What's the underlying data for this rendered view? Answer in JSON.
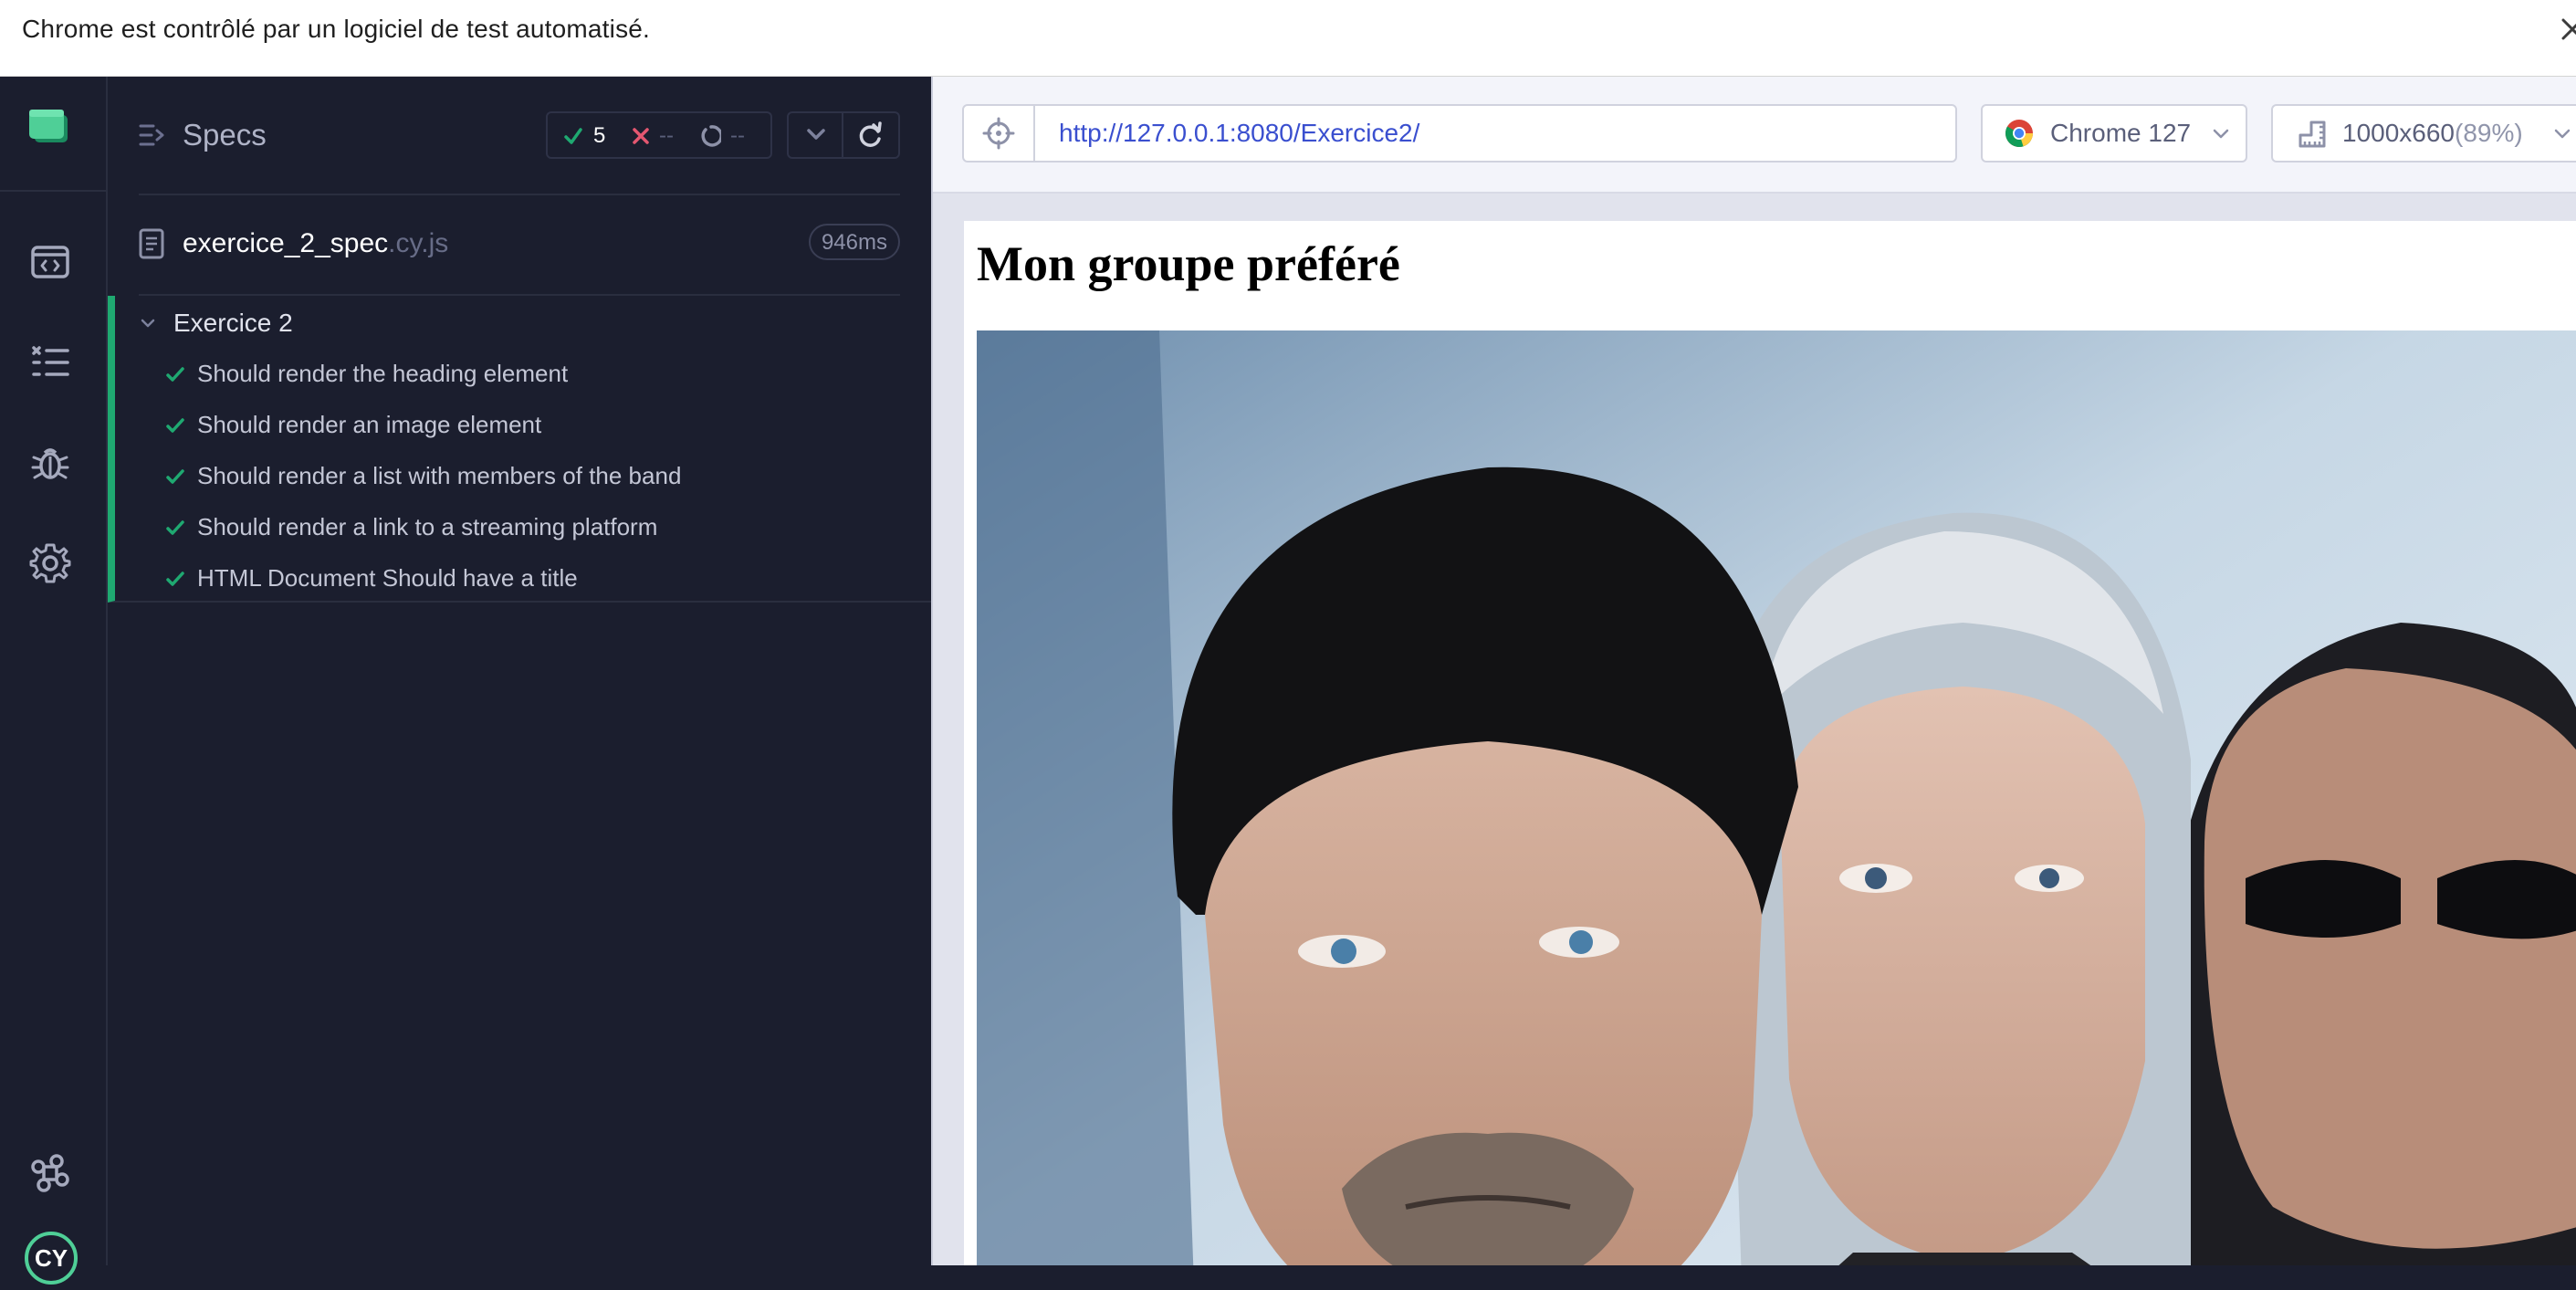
{
  "banner": {
    "text": "Chrome est contrôlé par un logiciel de test automatisé.",
    "close_icon": "close-icon"
  },
  "rail": {
    "logo": "cypress-app-logo",
    "items": [
      "specs-nav-icon",
      "runs-nav-icon",
      "debug-nav-icon",
      "settings-nav-icon"
    ],
    "bottom": [
      "keyboard-shortcuts-icon",
      "cypress-logo"
    ],
    "logo_text": "CY"
  },
  "specs": {
    "title": "Specs",
    "stats": {
      "passed": "5",
      "failed": "--",
      "pending": "--"
    },
    "file": {
      "name": "exercice_2_spec",
      "ext": ".cy.js",
      "duration": "946ms"
    },
    "suite": {
      "title": "Exercice 2",
      "tests": [
        {
          "title": "Should render the heading element",
          "status": "passed"
        },
        {
          "title": "Should render an image element",
          "status": "passed"
        },
        {
          "title": "Should render a list with members of the band",
          "status": "passed"
        },
        {
          "title": "Should render a link to a streaming platform",
          "status": "passed"
        },
        {
          "title": "HTML Document Should have a title",
          "status": "passed"
        }
      ]
    }
  },
  "aut": {
    "url": "http://127.0.0.1:8080/Exercice2/",
    "browser": "Chrome 127",
    "viewport": "1000x660",
    "scale": "(89%)",
    "page": {
      "heading": "Mon groupe préféré"
    }
  },
  "colors": {
    "passed": "#1fa971",
    "failed": "#e45770",
    "background": "#1b1e2e",
    "url": "#3a4fcf"
  }
}
